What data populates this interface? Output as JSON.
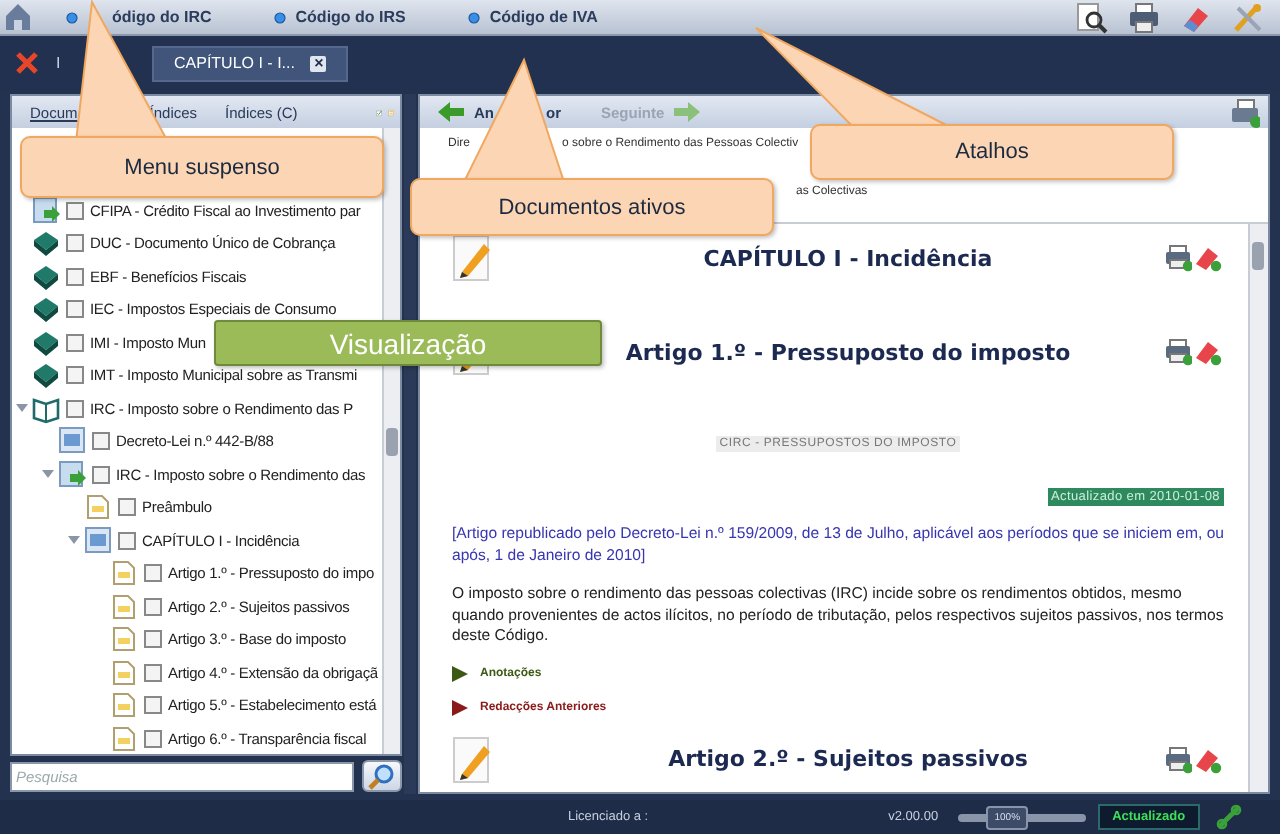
{
  "top_bar": {
    "links": [
      "ódigo do IRC",
      "Código do IRS",
      "Código de IVA"
    ]
  },
  "tab_row": {
    "tabs": [
      {
        "label": "I",
        "selected": false
      },
      {
        "label": "CAPÍTULO I - I...",
        "close": "×",
        "selected": true
      }
    ]
  },
  "left_panel": {
    "tabs": [
      {
        "label": "Docum",
        "selected": true
      },
      {
        "label": "Índices",
        "selected": false
      },
      {
        "label": "Índices (C)",
        "selected": false
      }
    ],
    "tree": [
      {
        "label": "CFIPA - Crédito Fiscal ao Investimento par",
        "kind": "doc-green",
        "checked": false
      },
      {
        "label": "DUC - Documento Único de Cobrança",
        "kind": "book",
        "checked": false
      },
      {
        "label": "EBF - Benefícios Fiscais",
        "kind": "book",
        "checked": false
      },
      {
        "label": "IEC - Impostos Especiais de Consumo",
        "kind": "book",
        "checked": false
      },
      {
        "label": "IMI - Imposto Mun",
        "kind": "book",
        "checked": false
      },
      {
        "label": "IMT - Imposto Municipal sobre as Transmi",
        "kind": "book",
        "checked": false
      },
      {
        "label": "IRC - Imposto sobre o Rendimento das P",
        "kind": "open-book",
        "checked": false,
        "expanded": true,
        "children": [
          {
            "label": "Decreto-Lei n.º 442-B/88",
            "kind": "doc-blue",
            "checked": false
          },
          {
            "label": "IRC - Imposto sobre o Rendimento das",
            "kind": "doc-green",
            "checked": false,
            "expanded": true,
            "children": [
              {
                "label": "Preâmbulo",
                "kind": "page",
                "checked": false
              },
              {
                "label": "CAPÍTULO I - Incidência",
                "kind": "doc-blue",
                "checked": false,
                "expanded": true,
                "children": [
                  {
                    "label": "Artigo 1.º - Pressuposto do impo",
                    "kind": "page",
                    "checked": false
                  },
                  {
                    "label": "Artigo 2.º - Sujeitos passivos",
                    "kind": "page",
                    "checked": false
                  },
                  {
                    "label": "Artigo 3.º - Base do imposto",
                    "kind": "page",
                    "checked": false
                  },
                  {
                    "label": "Artigo 4.º - Extensão da obrigaçã",
                    "kind": "page",
                    "checked": false
                  },
                  {
                    "label": "Artigo 5.º - Estabelecimento está",
                    "kind": "page",
                    "checked": false
                  },
                  {
                    "label": "Artigo 6.º - Transparência fiscal",
                    "kind": "page",
                    "checked": false
                  }
                ]
              }
            ]
          }
        ]
      }
    ],
    "search": {
      "placeholder": "Pesquisa"
    }
  },
  "right_panel": {
    "toolbar": {
      "back": {
        "parts": [
          "An",
          "or"
        ],
        "disabled": false
      },
      "forward": {
        "label": "Seguinte",
        "disabled": true
      }
    },
    "breadcrumb": [
      {
        "parts": [
          "Dire",
          "o sobre o Rendimento das Pessoas Colectiv"
        ]
      },
      {
        "parts": [
          "as Colectivas"
        ]
      }
    ],
    "document": [
      {
        "kind": "heading",
        "text": "CAPÍTULO I - Incidência"
      },
      {
        "kind": "heading",
        "text": "Artigo 1.º - Pressuposto do imposto"
      },
      {
        "kind": "label",
        "text": "CIRC - PRESSUPOSTOS DO IMPOSTO"
      },
      {
        "kind": "updated",
        "text": "Actualizado em 2010-01-08"
      },
      {
        "kind": "note",
        "text": "[Artigo republicado pelo Decreto-Lei n.º 159/2009, de 13 de Julho, aplicável aos períodos que se iniciem em, ou após, 1 de Janeiro de 2010]"
      },
      {
        "kind": "paragraph",
        "text": "O imposto sobre o rendimento das pessoas colectivas (IRC) incide sobre os rendimentos obtidos, mesmo quando provenientes de actos ilícitos, no período de tributação, pelos respectivos sujeitos passivos, nos termos deste Código."
      },
      {
        "kind": "section",
        "text": "Anotações",
        "color": "#3c5a14"
      },
      {
        "kind": "section",
        "text": "Redacções Anteriores",
        "color": "#8b1a1a"
      },
      {
        "kind": "heading",
        "text": "Artigo 2.º - Sujeitos passivos"
      }
    ]
  },
  "status_bar": {
    "license": "Licenciado a :",
    "version": "v2.00.00",
    "zoom": "100%",
    "level": 0.3,
    "state": "Actualizado"
  },
  "callouts": [
    {
      "text": "Menu suspenso",
      "color": "#fcd5b4"
    },
    {
      "text": "Documentos ativos",
      "color": "#fcd5b4"
    },
    {
      "text": "Atalhos",
      "color": "#fcd5b4"
    },
    {
      "text": "Visualização",
      "color": "#9bbb59"
    }
  ]
}
